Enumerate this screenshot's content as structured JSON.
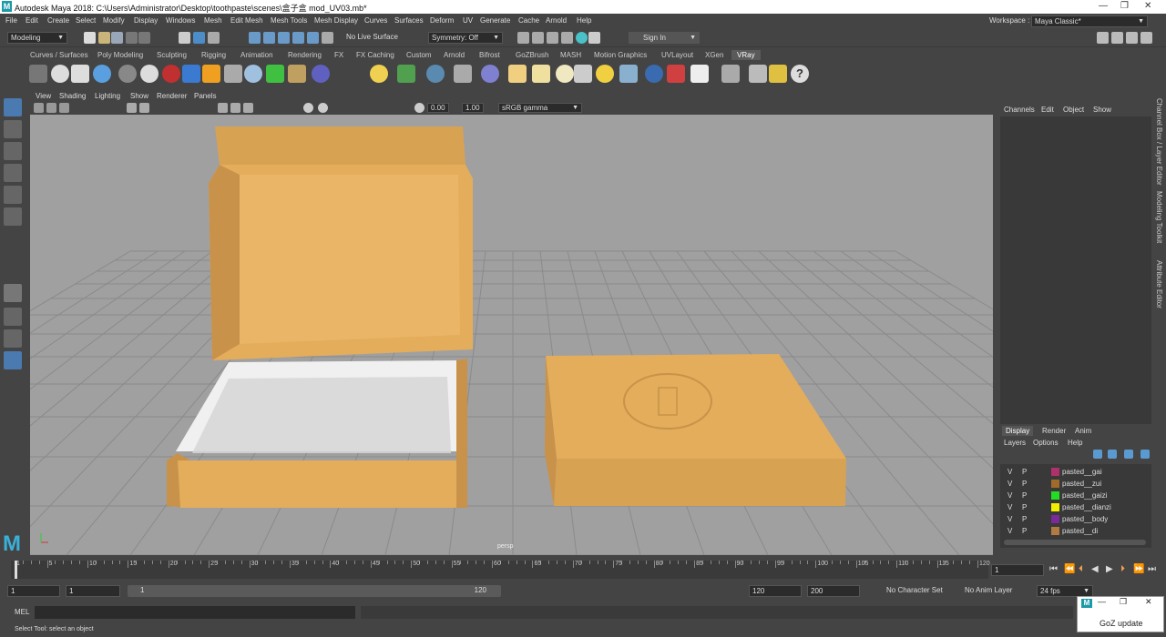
{
  "app": {
    "logo": "M",
    "title": "Autodesk Maya 2018: C:\\Users\\Administrator\\Desktop\\toothpaste\\scenes\\盒子盒 mod_UV03.mb*"
  },
  "window_controls": [
    "—",
    "❐",
    "✕"
  ],
  "menu": [
    "File",
    "Edit",
    "Create",
    "Select",
    "Modify",
    "Display",
    "Windows",
    "Mesh",
    "Edit Mesh",
    "Mesh Tools",
    "Mesh Display",
    "Curves",
    "Surfaces",
    "Deform",
    "UV",
    "Generate",
    "Cache",
    "Arnold",
    "Help"
  ],
  "workspace": {
    "label": "Workspace :",
    "value": "Maya Classic*"
  },
  "status": {
    "mode": "Modeling",
    "live_surface": "No Live Surface",
    "symmetry": "Symmetry: Off",
    "sign_in": "Sign In"
  },
  "shelf_tabs": [
    "Curves / Surfaces",
    "Poly Modeling",
    "Sculpting",
    "Rigging",
    "Animation",
    "Rendering",
    "FX",
    "FX Caching",
    "Custom",
    "Arnold",
    "Bifrost",
    "GoZBrush",
    "MASH",
    "Motion Graphics",
    "UVLayout",
    "XGen",
    "VRay"
  ],
  "shelf_active": "VRay",
  "viewport_menu": [
    "View",
    "Shading",
    "Lighting",
    "Show",
    "Renderer",
    "Panels"
  ],
  "viewport_tool": {
    "exposure": "0.00",
    "gamma": "1.00",
    "colorspace": "sRGB gamma"
  },
  "viewport_label": "persp",
  "channel_box": {
    "menu": [
      "Channels",
      "Edit",
      "Object",
      "Show"
    ]
  },
  "side_tabs": [
    "Channel Box / Layer Editor",
    "Modeling Toolkit",
    "Attribute Editor"
  ],
  "layer_editor": {
    "tabs": [
      "Display",
      "Render",
      "Anim"
    ],
    "active_tab": "Display",
    "menu": [
      "Layers",
      "Options",
      "Help"
    ],
    "layers": [
      {
        "v": "V",
        "p": "P",
        "name": "pasted__gai",
        "color": "#b0306a"
      },
      {
        "v": "V",
        "p": "P",
        "name": "pasted__zui",
        "color": "#a06a2a"
      },
      {
        "v": "V",
        "p": "P",
        "name": "pasted__gaizi",
        "color": "#22dd22"
      },
      {
        "v": "V",
        "p": "P",
        "name": "pasted__dianzi",
        "color": "#f0f000"
      },
      {
        "v": "V",
        "p": "P",
        "name": "pasted__body",
        "color": "#7a2a9a"
      },
      {
        "v": "V",
        "p": "P",
        "name": "pasted__di",
        "color": "#b07a40"
      }
    ]
  },
  "timeline": {
    "ticks": [
      "1",
      "5",
      "10",
      "15",
      "20",
      "25",
      "30",
      "35",
      "40",
      "45",
      "50",
      "55",
      "60",
      "65",
      "70",
      "75",
      "80",
      "85",
      "90",
      "95",
      "100",
      "105",
      "110",
      "115",
      "120"
    ],
    "current_frame": "1"
  },
  "range": {
    "start": "1",
    "inner_start": "1",
    "slider_start": "1",
    "slider_end": "120",
    "end": "120",
    "max": "200",
    "char_set": "No Character Set",
    "anim_layer": "No Anim Layer",
    "fps": "24 fps"
  },
  "mel": {
    "label": "MEL"
  },
  "help_line": "Select Tool: select an object",
  "goz": {
    "label": "GoZ update"
  },
  "colors": {
    "box": "#e3ad5c",
    "box_dark": "#c8924a",
    "viewport": "#a0a0a0",
    "grid": "#8a8a8a"
  }
}
